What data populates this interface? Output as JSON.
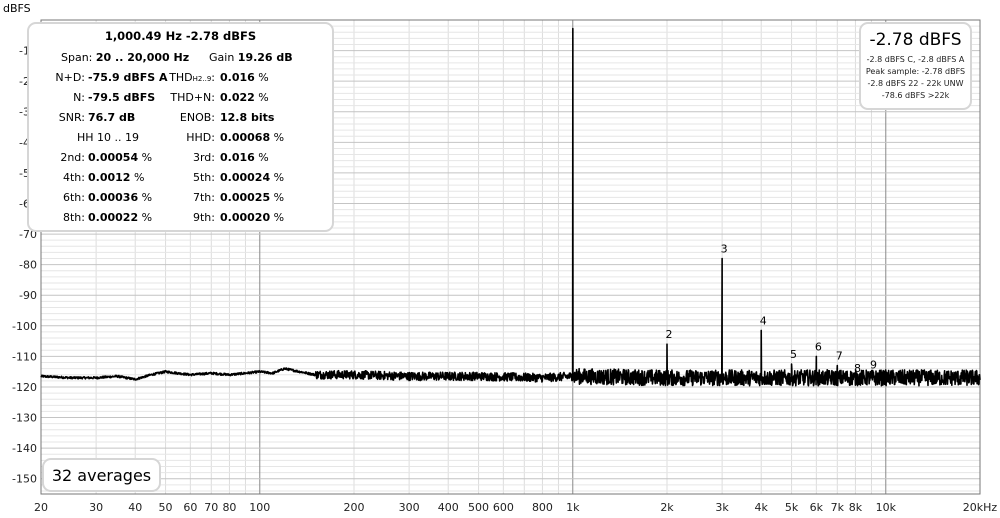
{
  "chart_data": {
    "type": "line",
    "ylabel": "dBFS",
    "xlabel": "",
    "x_scale": "log",
    "xlim": [
      20,
      20000
    ],
    "ylim": [
      -155,
      0
    ],
    "grid": true,
    "x_ticks": [
      {
        "v": 20,
        "label": "20"
      },
      {
        "v": 30,
        "label": "30"
      },
      {
        "v": 40,
        "label": "40"
      },
      {
        "v": 50,
        "label": "50"
      },
      {
        "v": 60,
        "label": "60"
      },
      {
        "v": 70,
        "label": "70"
      },
      {
        "v": 80,
        "label": "80"
      },
      {
        "v": 100,
        "label": "100"
      },
      {
        "v": 200,
        "label": "200"
      },
      {
        "v": 300,
        "label": "300"
      },
      {
        "v": 400,
        "label": "400"
      },
      {
        "v": 500,
        "label": "500"
      },
      {
        "v": 600,
        "label": "600"
      },
      {
        "v": 800,
        "label": "800"
      },
      {
        "v": 1000,
        "label": "1k"
      },
      {
        "v": 2000,
        "label": "2k"
      },
      {
        "v": 3000,
        "label": "3k"
      },
      {
        "v": 4000,
        "label": "4k"
      },
      {
        "v": 5000,
        "label": "5k"
      },
      {
        "v": 6000,
        "label": "6k"
      },
      {
        "v": 7000,
        "label": "7k"
      },
      {
        "v": 8000,
        "label": "8k"
      },
      {
        "v": 10000,
        "label": "10k"
      },
      {
        "v": 20000,
        "label": "20kHz"
      }
    ],
    "y_ticks": [
      -10,
      -20,
      -30,
      -40,
      -50,
      -60,
      -70,
      -80,
      -90,
      -100,
      -110,
      -120,
      -130,
      -140,
      -150
    ],
    "noise_floor": [
      [
        20,
        -116.5
      ],
      [
        25,
        -117
      ],
      [
        30,
        -117
      ],
      [
        35,
        -116.5
      ],
      [
        40,
        -117.5
      ],
      [
        45,
        -116
      ],
      [
        50,
        -115
      ],
      [
        60,
        -116
      ],
      [
        70,
        -115.5
      ],
      [
        80,
        -116
      ],
      [
        90,
        -115.5
      ],
      [
        100,
        -115
      ],
      [
        110,
        -115.5
      ],
      [
        120,
        -114
      ],
      [
        150,
        -116
      ],
      [
        200,
        -116
      ],
      [
        300,
        -116.5
      ],
      [
        500,
        -116.5
      ],
      [
        800,
        -117
      ],
      [
        1000,
        -116.5
      ],
      [
        2000,
        -117
      ],
      [
        5000,
        -117
      ],
      [
        10000,
        -117
      ],
      [
        20000,
        -117
      ]
    ],
    "peaks": [
      {
        "freq": 1000.49,
        "level": -2.78,
        "label": ""
      },
      {
        "freq": 2000,
        "level": -106,
        "label": "2"
      },
      {
        "freq": 3000,
        "level": -78,
        "label": "3"
      },
      {
        "freq": 4000,
        "level": -101.5,
        "label": "4"
      },
      {
        "freq": 5000,
        "level": -112.5,
        "label": "5"
      },
      {
        "freq": 6000,
        "level": -110,
        "label": "6"
      },
      {
        "freq": 7000,
        "level": -113,
        "label": "7"
      },
      {
        "freq": 8000,
        "level": -117,
        "label": "8"
      },
      {
        "freq": 9000,
        "level": -116,
        "label": "9"
      }
    ]
  },
  "info": {
    "header": "1,000.49 Hz  -2.78 dBFS",
    "span_label": "Span:",
    "span_value": "20 .. 20,000 Hz",
    "gain_label": "Gain",
    "gain_value": "19.26 dB",
    "nd_label": "N+D:",
    "nd_value": "-75.9 dBFS A",
    "thd_label": "THD",
    "thd_sub": "H2..9",
    "thd_value": "0.016",
    "n_label": "N:",
    "n_value": "-79.5 dBFS",
    "thdn_label": "THD+N:",
    "thdn_value": "0.022",
    "snr_label": "SNR:",
    "snr_value": "76.7 dB",
    "enob_label": "ENOB:",
    "enob_value": "12.8 bits",
    "hh_label": "HH 10 .. 19",
    "hhd_label": "HHD:",
    "hhd_value": "0.00068",
    "pct": "%",
    "harmonics": [
      {
        "label": "2nd:",
        "value": "0.00054"
      },
      {
        "label": "3rd:",
        "value": "0.016"
      },
      {
        "label": "4th:",
        "value": "0.0012"
      },
      {
        "label": "5th:",
        "value": "0.00024"
      },
      {
        "label": "6th:",
        "value": "0.00036"
      },
      {
        "label": "7th:",
        "value": "0.00025"
      },
      {
        "label": "8th:",
        "value": "0.00022"
      },
      {
        "label": "9th:",
        "value": "0.00020"
      }
    ]
  },
  "level_panel": {
    "main": "-2.78 dBFS",
    "line1": "-2.8 dBFS C, -2.8 dBFS A",
    "line2": "Peak sample: -2.78 dBFS",
    "line3": "-2.8 dBFS 22 - 22k UNW",
    "line4": "-78.6 dBFS >22k"
  },
  "averages": "32 averages"
}
